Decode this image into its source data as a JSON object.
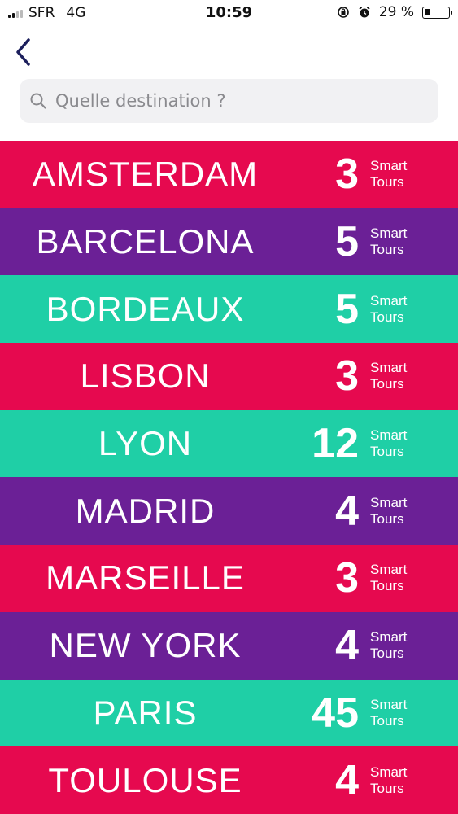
{
  "status_bar": {
    "carrier": "SFR",
    "network": "4G",
    "time": "10:59",
    "battery": "29 %"
  },
  "search": {
    "placeholder": "Quelle destination ?"
  },
  "colors": {
    "pink": "#e6094f",
    "purple": "#6b2096",
    "teal": "#1fcfa6"
  },
  "destinations": [
    {
      "city": "AMSTERDAM",
      "count": "3",
      "label_line1": "Smart",
      "label_line2": "Tours",
      "color": "#e6094f"
    },
    {
      "city": "BARCELONA",
      "count": "5",
      "label_line1": "Smart",
      "label_line2": "Tours",
      "color": "#6b2096"
    },
    {
      "city": "BORDEAUX",
      "count": "5",
      "label_line1": "Smart",
      "label_line2": "Tours",
      "color": "#1fcfa6"
    },
    {
      "city": "LISBON",
      "count": "3",
      "label_line1": "Smart",
      "label_line2": "Tours",
      "color": "#e6094f"
    },
    {
      "city": "LYON",
      "count": "12",
      "label_line1": "Smart",
      "label_line2": "Tours",
      "color": "#1fcfa6"
    },
    {
      "city": "MADRID",
      "count": "4",
      "label_line1": "Smart",
      "label_line2": "Tours",
      "color": "#6b2096"
    },
    {
      "city": "MARSEILLE",
      "count": "3",
      "label_line1": "Smart",
      "label_line2": "Tours",
      "color": "#e6094f"
    },
    {
      "city": "NEW YORK",
      "count": "4",
      "label_line1": "Smart",
      "label_line2": "Tours",
      "color": "#6b2096"
    },
    {
      "city": "PARIS",
      "count": "45",
      "label_line1": "Smart",
      "label_line2": "Tours",
      "color": "#1fcfa6"
    },
    {
      "city": "TOULOUSE",
      "count": "4",
      "label_line1": "Smart",
      "label_line2": "Tours",
      "color": "#e6094f"
    }
  ]
}
